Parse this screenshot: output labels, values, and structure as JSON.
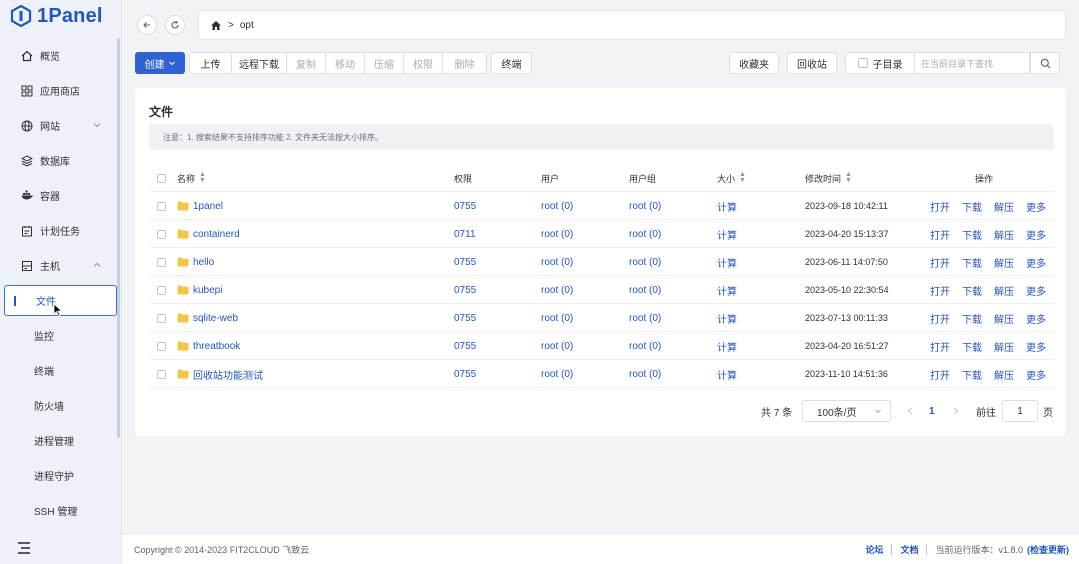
{
  "app": {
    "logo_text": "1Panel"
  },
  "sidebar": {
    "items": [
      {
        "label": "概览",
        "icon": "home-icon"
      },
      {
        "label": "应用商店",
        "icon": "grid-icon"
      },
      {
        "label": "网站",
        "icon": "globe-icon",
        "expandable": true
      },
      {
        "label": "数据库",
        "icon": "database-icon"
      },
      {
        "label": "容器",
        "icon": "docker-icon"
      },
      {
        "label": "计划任务",
        "icon": "calendar-icon"
      },
      {
        "label": "主机",
        "icon": "host-icon",
        "expanded": true
      }
    ],
    "sub_items": [
      {
        "label": "文件",
        "active": true
      },
      {
        "label": "监控"
      },
      {
        "label": "终端"
      },
      {
        "label": "防火墙"
      },
      {
        "label": "进程管理"
      },
      {
        "label": "进程守护"
      },
      {
        "label": "SSH 管理"
      }
    ]
  },
  "path": {
    "segments": [
      "opt"
    ],
    "separator": ">"
  },
  "toolbar": {
    "create_label": "创建",
    "upload_label": "上传",
    "remote_download_label": "远程下载",
    "copy_label": "复制",
    "move_label": "移动",
    "compress_label": "压缩",
    "permission_label": "权限",
    "delete_label": "删除",
    "terminal_label": "终端",
    "favorites_label": "收藏夹",
    "recycle_label": "回收站",
    "subdir_label": "子目录",
    "search_placeholder": "在当前目录下查找"
  },
  "card": {
    "title": "文件",
    "notice": "注意：1. 搜索结果不支持排序功能 2. 文件夹无法按大小排序。"
  },
  "table": {
    "headers": {
      "name": "名称",
      "permission": "权限",
      "user": "用户",
      "group": "用户组",
      "size": "大小",
      "mtime": "修改时间",
      "ops": "操作"
    },
    "rows": [
      {
        "name": "1panel",
        "perm": "0755",
        "user": "root (0)",
        "group": "root (0)",
        "size": "计算",
        "mtime": "2023-09-18 10:42:11"
      },
      {
        "name": "containerd",
        "perm": "0711",
        "user": "root (0)",
        "group": "root (0)",
        "size": "计算",
        "mtime": "2023-04-20 15:13:37"
      },
      {
        "name": "hello",
        "perm": "0755",
        "user": "root (0)",
        "group": "root (0)",
        "size": "计算",
        "mtime": "2023-06-11 14:07:50"
      },
      {
        "name": "kubepi",
        "perm": "0755",
        "user": "root (0)",
        "group": "root (0)",
        "size": "计算",
        "mtime": "2023-05-10 22:30:54"
      },
      {
        "name": "sqlite-web",
        "perm": "0755",
        "user": "root (0)",
        "group": "root (0)",
        "size": "计算",
        "mtime": "2023-07-13 00:11:33"
      },
      {
        "name": "threatbook",
        "perm": "0755",
        "user": "root (0)",
        "group": "root (0)",
        "size": "计算",
        "mtime": "2023-04-20 16:51:27"
      },
      {
        "name": "回收站功能测试",
        "perm": "0755",
        "user": "root (0)",
        "group": "root (0)",
        "size": "计算",
        "mtime": "2023-11-10 14:51:36"
      }
    ],
    "row_ops": [
      "打开",
      "下载",
      "解压",
      "更多"
    ]
  },
  "pagination": {
    "total": "共 7 条",
    "page_size": "100条/页",
    "current_page": "1",
    "goto_label": "前往",
    "goto_value": "1",
    "page_unit": "页"
  },
  "footer": {
    "copyright": "Copyright © 2014-2023 FIT2CLOUD 飞致云",
    "forum": "论坛",
    "docs": "文档",
    "version_label": "当前运行版本：v1.8.0",
    "check_update": "(检查更新)"
  },
  "colors": {
    "accent": "#2f62d7",
    "folder": "#f5c542",
    "sidebar_bg": "#eef1f7"
  }
}
